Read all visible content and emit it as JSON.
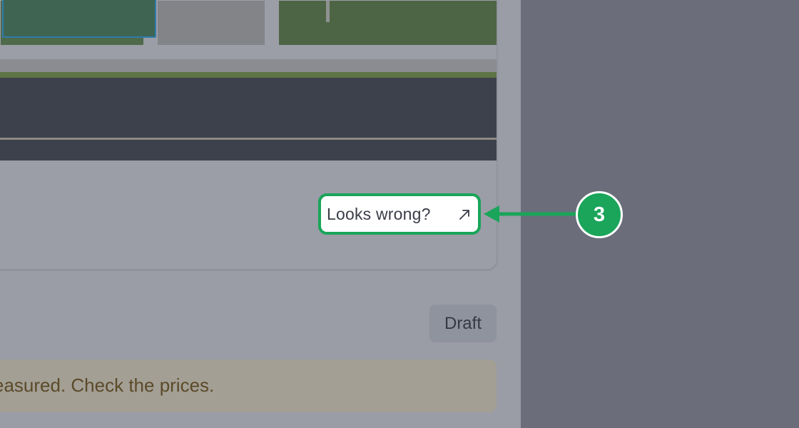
{
  "card": {
    "looks_wrong_label": "Looks wrong?",
    "looks_wrong_icon": "external-arrow-icon"
  },
  "callout": {
    "step_number": "3",
    "color": "#1aa55a"
  },
  "status": {
    "badge_label": "Draft"
  },
  "notice": {
    "text": "easured. Check the prices."
  }
}
